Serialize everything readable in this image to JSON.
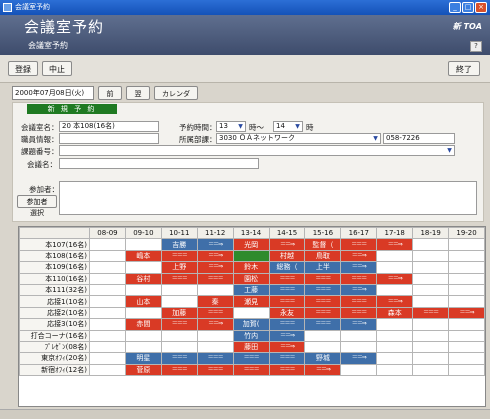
{
  "window": {
    "title": "会議室予約",
    "minimize_glyph": "_",
    "restore_glyph": "□",
    "close_glyph": "×"
  },
  "header": {
    "title": "会議室予約",
    "subtitle": "会議室予約",
    "brand": "新 TOA",
    "help_label": "?"
  },
  "toolbar": {
    "register_label": "登録",
    "cancel_label": "中止",
    "exit_label": "終了"
  },
  "nav": {
    "date": "2000年07月08日(火)",
    "prev_label": "前日",
    "next_label": "翌日",
    "calendar_label": "カレンダー"
  },
  "form": {
    "badge": "新 規 予 約",
    "room_label": "会議室名：",
    "room_value": "20 本108(16名)",
    "staff_label": "職員情報：",
    "staff_value": "",
    "subject_no_label": "課題番号：",
    "subject_no_value": "",
    "meeting_label": "会議名：",
    "meeting_value": "",
    "time_label": "予約時間：",
    "time_from": "13",
    "time_sep": "時～",
    "time_to": "14",
    "time_suffix": "時",
    "dept_label": "所属部課：",
    "dept_value": "3030 ＯＡネットワーク",
    "dept_phone": "058-7226",
    "attendees_label": "参加者：",
    "attendees_value": "",
    "select_attendees_label": "参加者選択"
  },
  "schedule": {
    "time_headers": [
      "08-09",
      "09-10",
      "10-11",
      "11-12",
      "13-14",
      "14-15",
      "15-16",
      "16-17",
      "17-18",
      "18-19",
      "19-20"
    ],
    "rows": [
      {
        "room": "本107(16名)",
        "cells": [
          [
            "",
            ""
          ],
          [
            "",
            ""
          ],
          [
            "吉勝",
            "blue"
          ],
          [
            "＝＝⇒",
            "blue"
          ],
          [
            "光岡",
            "red"
          ],
          [
            "＝＝⇒",
            "red"
          ],
          [
            "監督（",
            "red"
          ],
          [
            "＝＝＝",
            "red"
          ],
          [
            "＝＝⇒",
            "red"
          ],
          [
            "",
            ""
          ],
          [
            "",
            ""
          ]
        ]
      },
      {
        "room": "本108(16名)",
        "cells": [
          [
            "",
            ""
          ],
          [
            "嶋本",
            "red"
          ],
          [
            "＝＝＝",
            "red"
          ],
          [
            "＝＝⇒",
            "red"
          ],
          [
            "",
            "green"
          ],
          [
            "村越",
            "red"
          ],
          [
            "鳥取",
            "red"
          ],
          [
            "＝＝⇒",
            "red"
          ],
          [
            "",
            ""
          ],
          [
            "",
            ""
          ],
          [
            "",
            ""
          ]
        ]
      },
      {
        "room": "本109(16名)",
        "cells": [
          [
            "",
            ""
          ],
          [
            "",
            ""
          ],
          [
            "上野",
            "red"
          ],
          [
            "＝＝⇒",
            "red"
          ],
          [
            "鈴木",
            "red"
          ],
          [
            "総務（",
            "blue"
          ],
          [
            "上半",
            "blue"
          ],
          [
            "＝＝⇒",
            "blue"
          ],
          [
            "",
            ""
          ],
          [
            "",
            ""
          ],
          [
            "",
            ""
          ]
        ]
      },
      {
        "room": "本110(16名)",
        "cells": [
          [
            "",
            ""
          ],
          [
            "谷村",
            "red"
          ],
          [
            "＝＝＝",
            "red"
          ],
          [
            "＝＝＝",
            "red"
          ],
          [
            "園松",
            "red"
          ],
          [
            "＝＝＝",
            "red"
          ],
          [
            "＝＝＝",
            "red"
          ],
          [
            "＝＝＝",
            "red"
          ],
          [
            "＝＝⇒",
            "red"
          ],
          [
            "",
            ""
          ],
          [
            "",
            ""
          ]
        ]
      },
      {
        "room": "本111(32名)",
        "cells": [
          [
            "",
            ""
          ],
          [
            "",
            ""
          ],
          [
            "",
            ""
          ],
          [
            "",
            ""
          ],
          [
            "工藤",
            "blue"
          ],
          [
            "＝＝＝",
            "blue"
          ],
          [
            "＝＝＝",
            "blue"
          ],
          [
            "＝＝⇒",
            "blue"
          ],
          [
            "",
            ""
          ],
          [
            "",
            ""
          ],
          [
            "",
            ""
          ]
        ]
      },
      {
        "room": "応接1(10名)",
        "cells": [
          [
            "",
            ""
          ],
          [
            "山本",
            "red"
          ],
          [
            "",
            ""
          ],
          [
            "秦",
            "red"
          ],
          [
            "瀬見",
            "red"
          ],
          [
            "＝＝＝",
            "red"
          ],
          [
            "＝＝＝",
            "red"
          ],
          [
            "＝＝＝",
            "red"
          ],
          [
            "＝＝⇒",
            "red"
          ],
          [
            "",
            ""
          ],
          [
            "",
            ""
          ]
        ]
      },
      {
        "room": "応接2(10名)",
        "cells": [
          [
            "",
            ""
          ],
          [
            "",
            ""
          ],
          [
            "加藤",
            "red"
          ],
          [
            "＝＝＝",
            "red"
          ],
          [
            "",
            ""
          ],
          [
            "永友",
            "red"
          ],
          [
            "＝＝＝",
            "red"
          ],
          [
            "＝＝＝",
            "red"
          ],
          [
            "森本",
            "red"
          ],
          [
            "＝＝＝",
            "red"
          ],
          [
            "＝＝⇒",
            "red"
          ]
        ]
      },
      {
        "room": "応接3(10名)",
        "cells": [
          [
            "",
            ""
          ],
          [
            "赤間",
            "red"
          ],
          [
            "＝＝＝",
            "red"
          ],
          [
            "＝＝⇒",
            "red"
          ],
          [
            "加賀(",
            "blue"
          ],
          [
            "＝＝＝",
            "blue"
          ],
          [
            "＝＝＝",
            "blue"
          ],
          [
            "＝＝⇒",
            "blue"
          ],
          [
            "",
            ""
          ],
          [
            "",
            ""
          ],
          [
            "",
            ""
          ]
        ]
      },
      {
        "room": "打合コーナ(16名)",
        "cells": [
          [
            "",
            ""
          ],
          [
            "",
            ""
          ],
          [
            "",
            ""
          ],
          [
            "",
            ""
          ],
          [
            "竹内",
            "blue"
          ],
          [
            "＝＝⇒",
            "blue"
          ],
          [
            "",
            ""
          ],
          [
            "",
            ""
          ],
          [
            "",
            ""
          ],
          [
            "",
            ""
          ],
          [
            "",
            ""
          ]
        ]
      },
      {
        "room": "ﾌﾟﾚｾﾞﾝ(08名)",
        "cells": [
          [
            "",
            ""
          ],
          [
            "",
            ""
          ],
          [
            "",
            ""
          ],
          [
            "",
            ""
          ],
          [
            "藤田",
            "red"
          ],
          [
            "＝＝⇒",
            "red"
          ],
          [
            "",
            ""
          ],
          [
            "",
            ""
          ],
          [
            "",
            ""
          ],
          [
            "",
            ""
          ],
          [
            "",
            ""
          ]
        ]
      },
      {
        "room": "東京ｵﾌｨ(20名)",
        "cells": [
          [
            "",
            ""
          ],
          [
            "明星",
            "blue"
          ],
          [
            "＝＝＝",
            "blue"
          ],
          [
            "＝＝＝",
            "blue"
          ],
          [
            "＝＝＝",
            "blue"
          ],
          [
            "＝＝＝",
            "blue"
          ],
          [
            "野城",
            "blue"
          ],
          [
            "＝＝⇒",
            "blue"
          ],
          [
            "",
            ""
          ],
          [
            "",
            ""
          ],
          [
            "",
            ""
          ]
        ]
      },
      {
        "room": "新宿ｵﾌｨ(12名)",
        "cells": [
          [
            "",
            ""
          ],
          [
            "菅原",
            "red"
          ],
          [
            "＝＝＝",
            "red"
          ],
          [
            "＝＝＝",
            "red"
          ],
          [
            "＝＝＝",
            "red"
          ],
          [
            "＝＝＝",
            "red"
          ],
          [
            "＝＝⇒",
            "red"
          ],
          [
            "",
            ""
          ],
          [
            "",
            ""
          ],
          [
            "",
            ""
          ],
          [
            "",
            ""
          ]
        ]
      }
    ]
  },
  "colors": {
    "reserved_red": "#d93a25",
    "reserved_blue": "#3f6fa9",
    "selected_green": "#2e8b2c"
  }
}
